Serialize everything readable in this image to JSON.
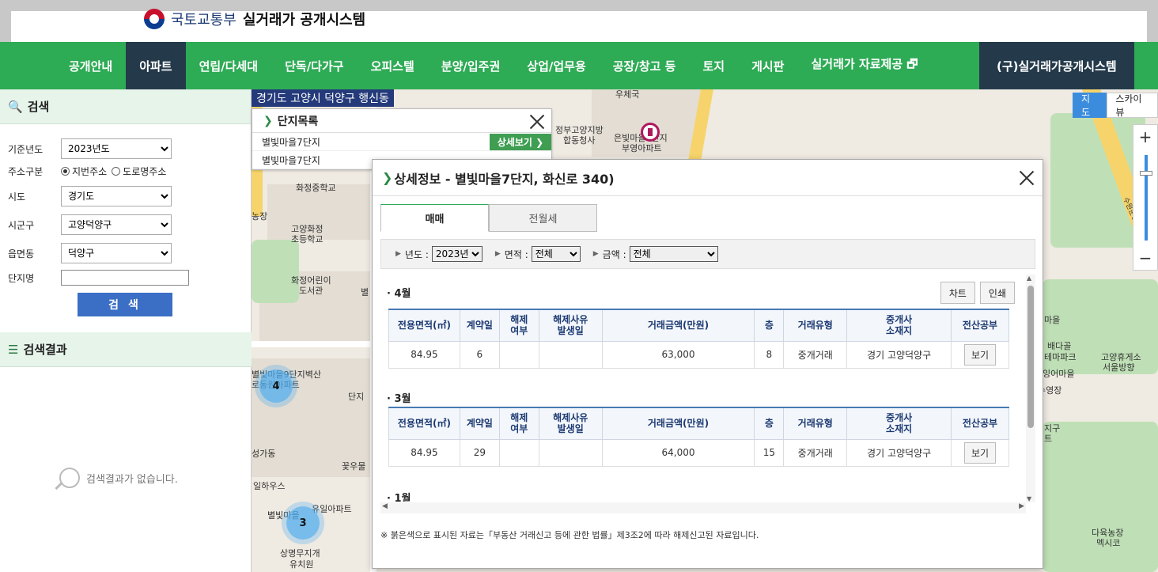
{
  "header": {
    "ministry": "국토교통부",
    "system": "실거래가 공개시스템"
  },
  "nav": {
    "items": [
      "공개안내",
      "아파트",
      "연립/다세대",
      "단독/다가구",
      "오피스텔",
      "분양/입주권",
      "상업/업무용",
      "공장/창고 등",
      "토지",
      "게시판",
      "실거래가 자료제공 🗗"
    ],
    "active": "아파트",
    "old_system": "(구)실거래가공개시스템"
  },
  "search": {
    "title": "검색",
    "year_label": "기준년도",
    "year_value": "2023년도",
    "addr_label": "주소구분",
    "addr_opt1": "지번주소",
    "addr_opt2": "도로명주소",
    "sido_label": "시도",
    "sido_value": "경기도",
    "sigungu_label": "시군구",
    "sigungu_value": "고양덕양구",
    "dong_label": "읍면동",
    "dong_value": "덕양구",
    "name_label": "단지명",
    "name_value": "",
    "button": "검 색"
  },
  "results": {
    "title": "검색결과",
    "empty": "검색결과가 없습니다."
  },
  "map": {
    "address": "경기도 고양시 덕양구 행신동",
    "type_map": "지도",
    "type_sky": "스카이뷰",
    "zoom_in": "+",
    "zoom_out": "−",
    "cluster_a": "4",
    "cluster_b": "3",
    "labels": [
      "우체국",
      "정부고양지방",
      "합동청사",
      "은빛마을6단지",
      "부영아파트",
      "화정중학교",
      "고양화정",
      "초등학교",
      "화정어린이",
      "도서관",
      "별빛마을9단지벽산",
      "로동원아파트",
      "별빛마을",
      "유일아파트",
      "상명무지개",
      "유치원",
      "꽃우물",
      "일하우스",
      "성가동",
      "마을",
      "배다골",
      "테마파크",
      "잉어마을",
      "수영장",
      "고양휴게소",
      "서울방향",
      "다육농장",
      "멕시코",
      "지구",
      "트",
      "농장",
      "별",
      "단지",
      "수원문산고속도로"
    ]
  },
  "complex_list": {
    "title": "단지목록",
    "items": [
      "별빛마을7단지",
      "별빛마을7단지"
    ],
    "detail_btn": "상세보기"
  },
  "detail": {
    "title": "상세정보 - 별빛마을7단지, 화신로 340)",
    "tab_sale": "매매",
    "tab_rent": "전월세",
    "filter_year_label": "년도 :",
    "filter_year_value": "2023년",
    "filter_area_label": "면적 :",
    "filter_area_value": "전체",
    "filter_price_label": "금액 :",
    "filter_price_value": "전체",
    "chart_btn": "차트",
    "print_btn": "인쇄",
    "columns": [
      "전용면적(㎡)",
      "계약일",
      "해제\n여부",
      "해제사유\n발생일",
      "거래금액(만원)",
      "층",
      "거래유형",
      "중개사\n소재지",
      "전산공부"
    ],
    "months": [
      {
        "label": "· 4월",
        "rows": [
          [
            "84.95",
            "6",
            "",
            "",
            "63,000",
            "8",
            "중개거래",
            "경기 고양덕양구",
            "보기"
          ]
        ]
      },
      {
        "label": "· 3월",
        "rows": [
          [
            "84.95",
            "29",
            "",
            "",
            "64,000",
            "15",
            "중개거래",
            "경기 고양덕양구",
            "보기"
          ]
        ]
      },
      {
        "label": "· 1월",
        "rows": []
      }
    ],
    "note": "※ 붉은색으로 표시된 자료는「부동산 거래신고 등에 관한 법률」제3조2에 따라 해제신고된 자료입니다."
  }
}
